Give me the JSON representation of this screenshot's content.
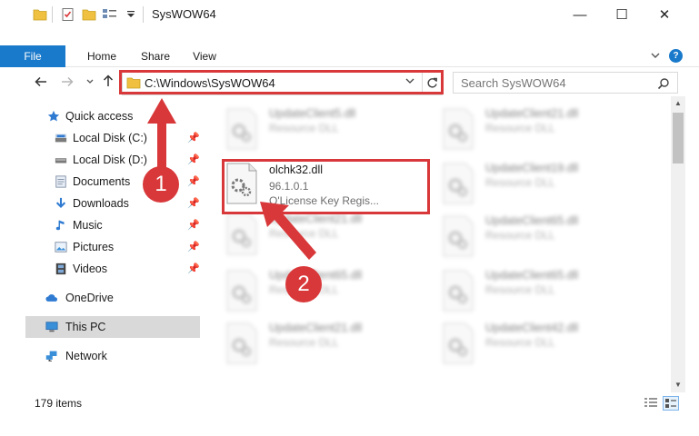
{
  "window": {
    "title": "SysWOW64",
    "minimize": "—",
    "maximize": "☐",
    "close": "✕"
  },
  "ribbon": {
    "tabs": [
      {
        "label": "File"
      },
      {
        "label": "Home"
      },
      {
        "label": "Share"
      },
      {
        "label": "View"
      }
    ],
    "help": "?"
  },
  "nav": {
    "address": "C:\\Windows\\SysWOW64",
    "search_placeholder": "Search SysWOW64"
  },
  "sidebar": {
    "items": [
      {
        "label": "Quick access"
      },
      {
        "label": "Local Disk (C:)"
      },
      {
        "label": "Local Disk (D:)"
      },
      {
        "label": "Documents"
      },
      {
        "label": "Downloads"
      },
      {
        "label": "Music"
      },
      {
        "label": "Pictures"
      },
      {
        "label": "Videos"
      },
      {
        "label": "OneDrive"
      },
      {
        "label": "This PC"
      },
      {
        "label": "Network"
      }
    ]
  },
  "files": {
    "selected": {
      "name": "olchk32.dll",
      "version": "96.1.0.1",
      "description": "O'License Key Regis..."
    },
    "background": [
      {
        "name": "UpdateClient5.dll",
        "type": "Resource DLL"
      },
      {
        "name": "UpdateClient21.dll",
        "type": "Resource DLL"
      },
      {
        "name": "UpdateClient19.dll",
        "type": "Resource DLL"
      },
      {
        "name": "UpdateClient21.dll",
        "type": "Resource DLL"
      },
      {
        "name": "UpdateClient65.dll",
        "type": "Resource DLL"
      },
      {
        "name": "UpdateClient65.dll",
        "type": "Resource DLL"
      },
      {
        "name": "UpdateClient65.dll",
        "type": "Resource DLL"
      },
      {
        "name": "UpdateClient21.dll",
        "type": "Resource DLL"
      },
      {
        "name": "UpdateClient42.dll",
        "type": "Resource DLL"
      }
    ]
  },
  "status": {
    "item_count": "179 items"
  },
  "annotations": {
    "step1": "1",
    "step2": "2",
    "color": "#d9383a"
  },
  "colors": {
    "accent": "#1979ca",
    "folder": "#f0c040"
  }
}
